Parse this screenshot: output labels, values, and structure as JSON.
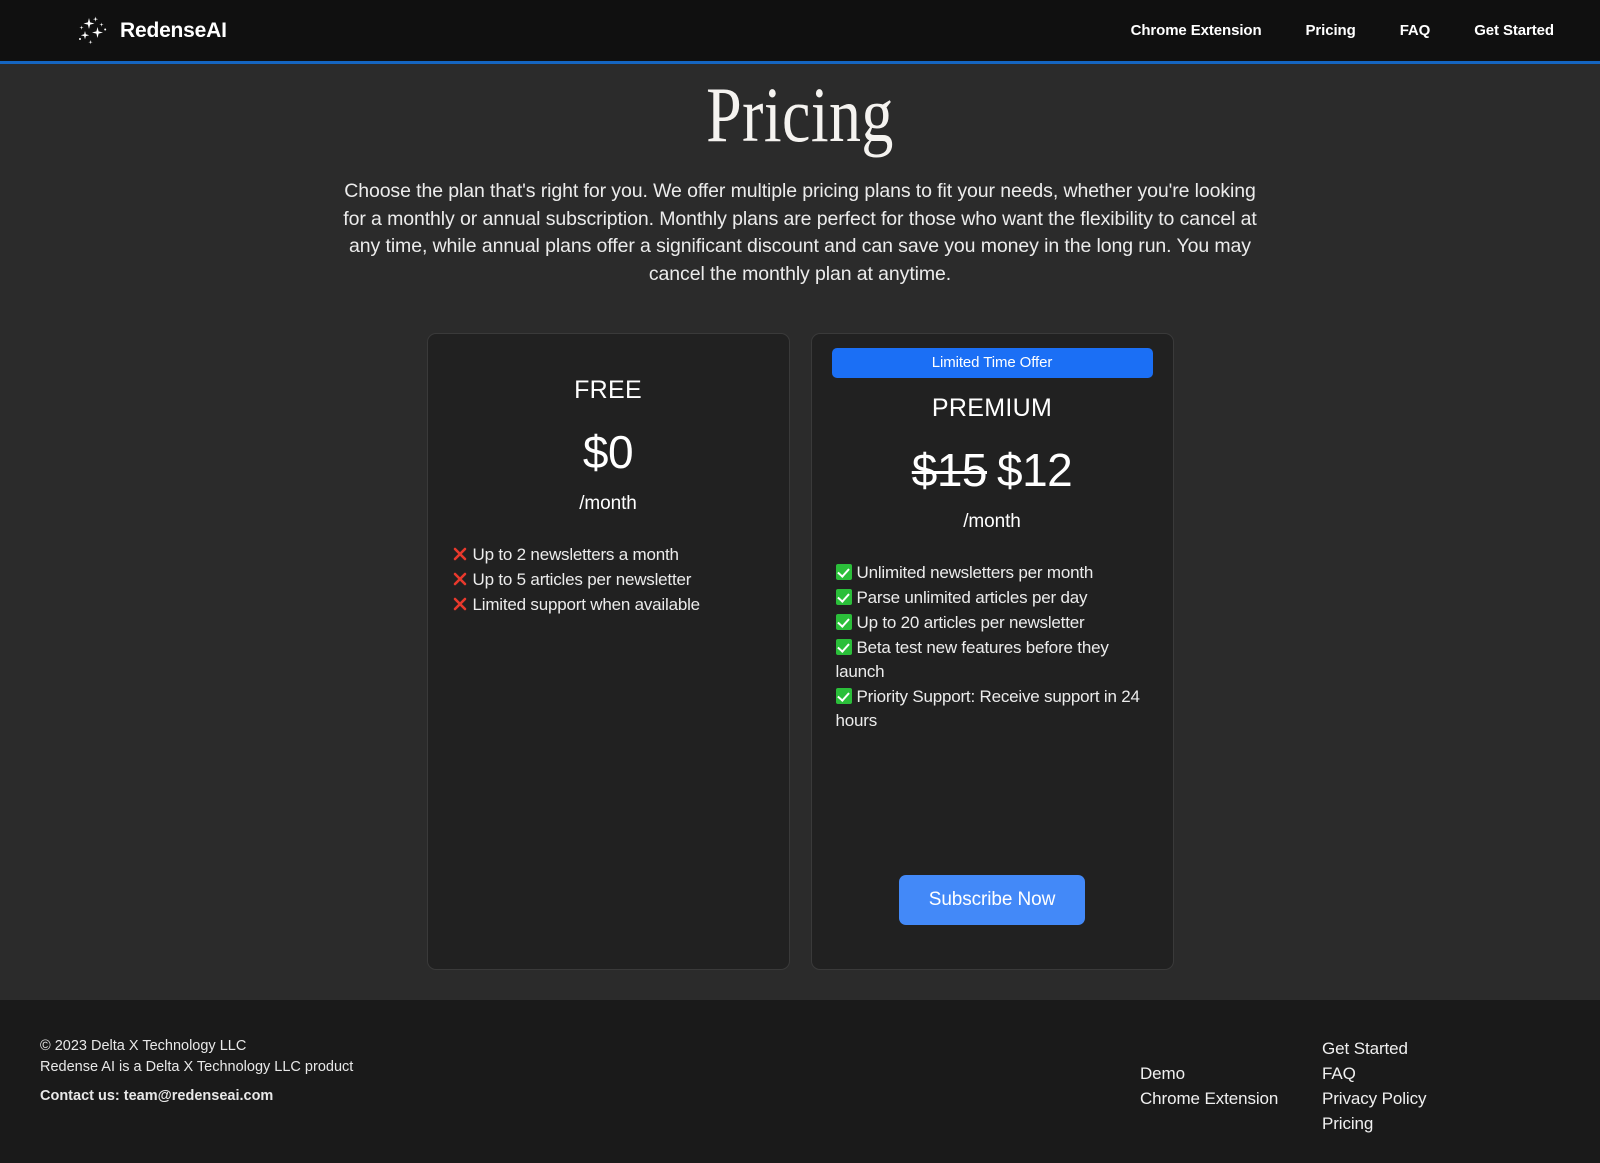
{
  "header": {
    "brand": {
      "name": "RedenseAI",
      "logo_icon": "sparkles-icon"
    },
    "nav": [
      {
        "label": "Chrome Extension"
      },
      {
        "label": "Pricing"
      },
      {
        "label": "FAQ"
      },
      {
        "label": "Get Started"
      }
    ],
    "accent_border_color": "#1565c0",
    "background_color": "#101010"
  },
  "hero": {
    "title": "Pricing",
    "description": "Choose the plan that's right for you. We offer multiple pricing plans to fit your needs, whether you're looking for a monthly or annual subscription. Monthly plans are perfect for those who want the flexibility to cancel at any time, while annual plans offer a significant discount and can save you money in the long run. You may cancel the monthly plan at anytime."
  },
  "plans": {
    "free": {
      "name": "FREE",
      "price": "$0",
      "period": "/month",
      "features": [
        "Up to 2 newsletters a month",
        "Up to 5 articles per newsletter",
        "Limited support when available"
      ],
      "feature_icon": "red-x-icon"
    },
    "premium": {
      "badge": "Limited Time Offer",
      "badge_color": "#1b6ff5",
      "name": "PREMIUM",
      "price_old": "$15",
      "price": "$12",
      "period": "/month",
      "features": [
        "Unlimited newsletters per month",
        "Parse unlimited articles per day",
        "Up to 20 articles per newsletter",
        "Beta test new features before they launch",
        "Priority Support: Receive support in 24 hours"
      ],
      "feature_icon": "green-check-icon",
      "cta_label": "Subscribe Now",
      "cta_color": "#4389f8"
    }
  },
  "footer": {
    "copyright": "© 2023 Delta X Technology LLC",
    "product_line": "Redense AI is a Delta X Technology LLC product",
    "contact": "Contact us: team@redenseai.com",
    "column_a": [
      {
        "label": "Demo"
      },
      {
        "label": "Chrome Extension"
      }
    ],
    "column_b": [
      {
        "label": "Get Started"
      },
      {
        "label": "FAQ"
      },
      {
        "label": "Privacy Policy"
      },
      {
        "label": "Pricing"
      }
    ]
  }
}
